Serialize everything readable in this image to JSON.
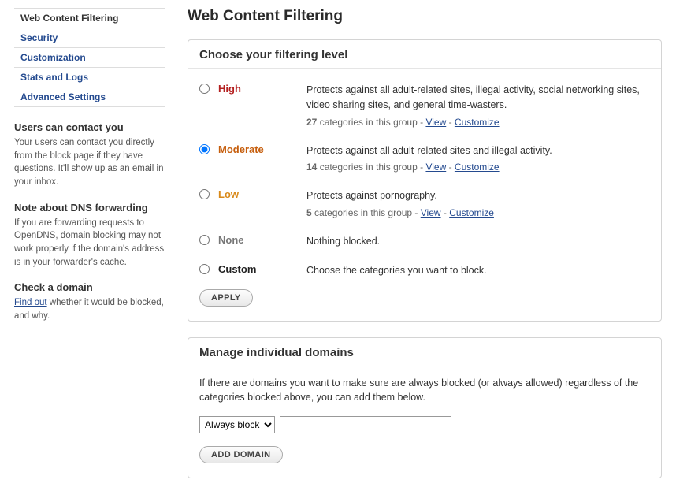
{
  "sidebar": {
    "items": [
      {
        "label": "Web Content Filtering",
        "active": true
      },
      {
        "label": "Security",
        "active": false
      },
      {
        "label": "Customization",
        "active": false
      },
      {
        "label": "Stats and Logs",
        "active": false
      },
      {
        "label": "Advanced Settings",
        "active": false
      }
    ],
    "sections": {
      "contact": {
        "heading": "Users can contact you",
        "body": "Your users can contact you directly from the block page if they have questions. It'll show up as an email in your inbox."
      },
      "dns": {
        "heading": "Note about DNS forwarding",
        "body": "If you are forwarding requests to OpenDNS, domain blocking may not work properly if the domain's address is in your forwarder's cache."
      },
      "check": {
        "heading": "Check a domain",
        "link_text": "Find out",
        "body_rest": " whether it would be blocked, and why."
      }
    }
  },
  "page": {
    "title": "Web Content Filtering"
  },
  "filtering": {
    "heading": "Choose your filtering level",
    "levels": {
      "high": {
        "label": "High",
        "desc": "Protects against all adult-related sites, illegal activity, social networking sites, video sharing sites, and general time-wasters.",
        "count": "27",
        "count_suffix": " categories in this group - ",
        "view": "View",
        "sep": " - ",
        "customize": "Customize"
      },
      "moderate": {
        "label": "Moderate",
        "desc": "Protects against all adult-related sites and illegal activity.",
        "count": "14",
        "count_suffix": " categories in this group - ",
        "view": "View",
        "sep": " - ",
        "customize": "Customize"
      },
      "low": {
        "label": "Low",
        "desc": "Protects against pornography.",
        "count": "5",
        "count_suffix": " categories in this group - ",
        "view": "View",
        "sep": " - ",
        "customize": "Customize"
      },
      "none": {
        "label": "None",
        "desc": "Nothing blocked."
      },
      "custom": {
        "label": "Custom",
        "desc": "Choose the categories you want to block."
      }
    },
    "selected": "moderate",
    "apply_label": "APPLY"
  },
  "domains": {
    "heading": "Manage individual domains",
    "desc": "If there are domains you want to make sure are always blocked (or always allowed) regardless of the categories blocked above, you can add them below.",
    "select_value": "Always block",
    "input_value": "",
    "add_label": "ADD DOMAIN"
  }
}
